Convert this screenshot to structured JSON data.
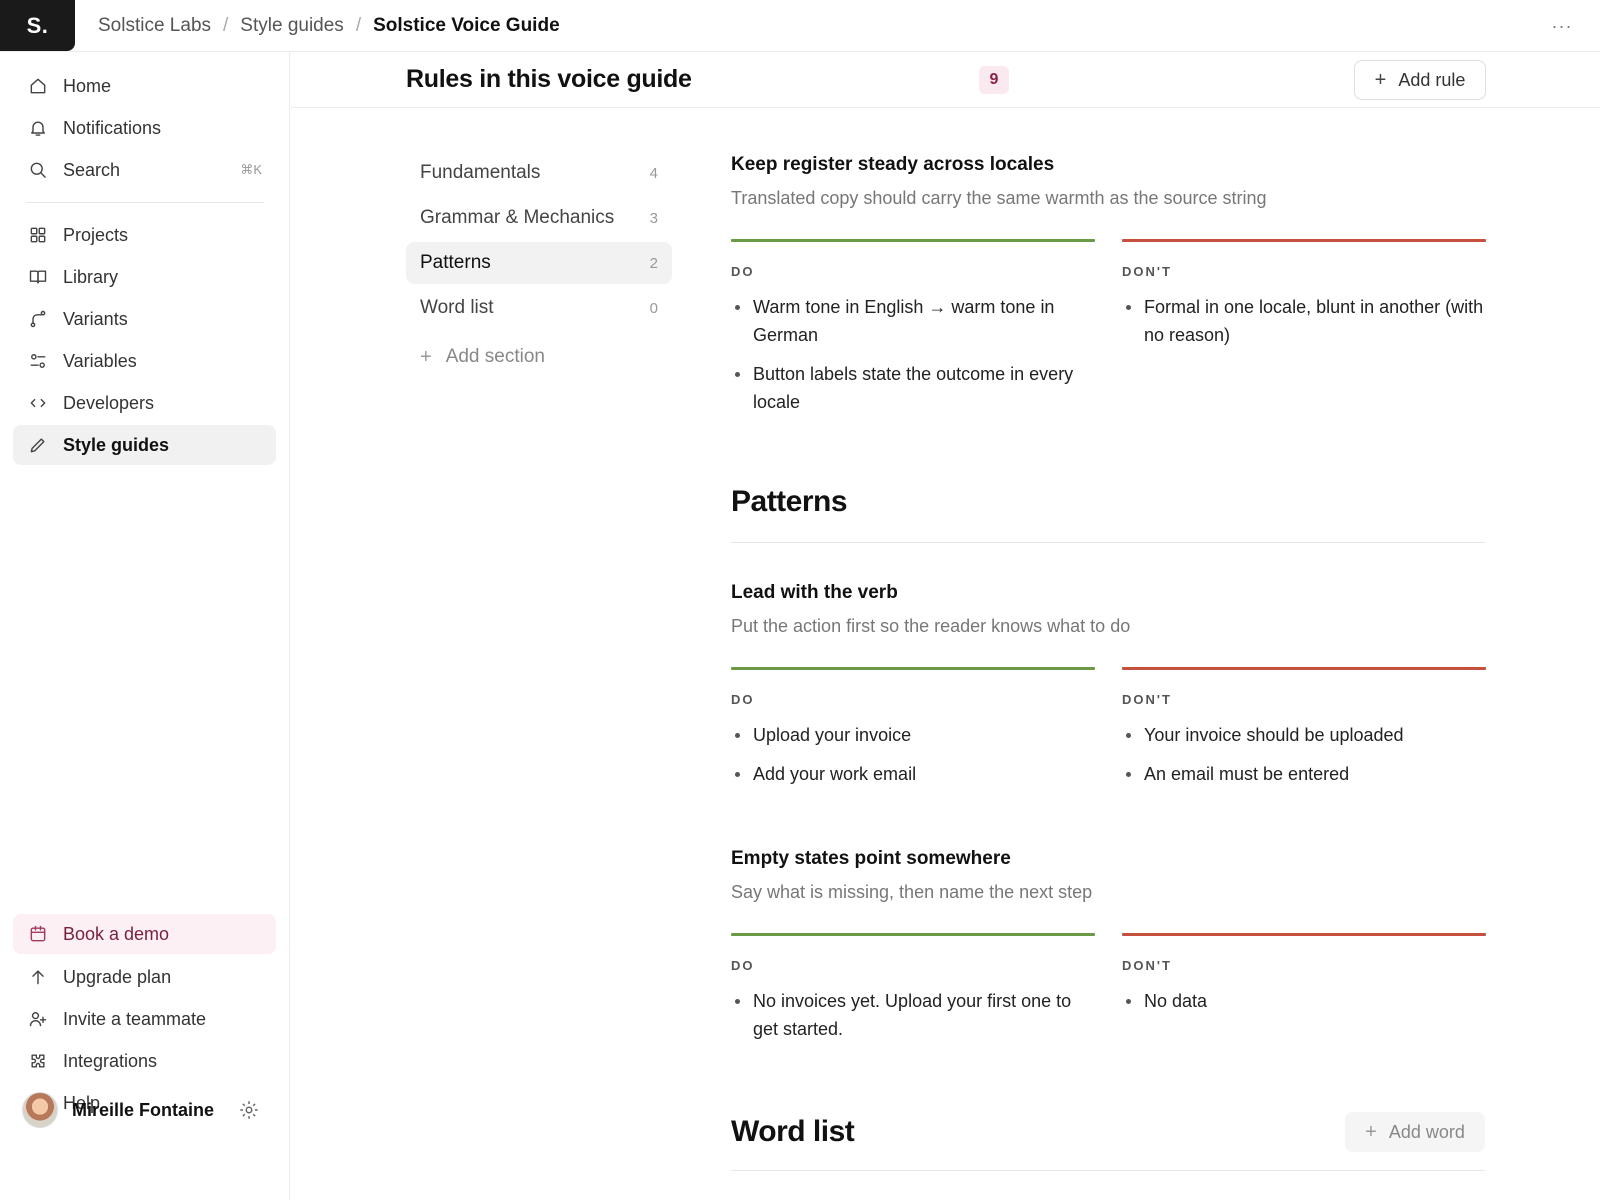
{
  "topbar": {
    "logo": "S.",
    "breadcrumb": [
      "Solstice Labs",
      "Style guides",
      "Solstice Voice Guide"
    ],
    "more_icon": "more-horizontal-icon"
  },
  "sidebar": {
    "primary": [
      {
        "label": "Home",
        "icon": "home-icon"
      },
      {
        "label": "Notifications",
        "icon": "bell-icon"
      },
      {
        "label": "Search",
        "icon": "search-icon",
        "shortcut": "⌘K"
      }
    ],
    "workspace": [
      {
        "label": "Projects",
        "icon": "grid-icon"
      },
      {
        "label": "Library",
        "icon": "book-icon"
      },
      {
        "label": "Variants",
        "icon": "branch-icon"
      },
      {
        "label": "Variables",
        "icon": "variables-icon"
      },
      {
        "label": "Developers",
        "icon": "code-icon"
      },
      {
        "label": "Style guides",
        "icon": "pencil-icon",
        "active": true
      }
    ],
    "bottom": [
      {
        "label": "Book a demo",
        "icon": "calendar-icon",
        "highlight_color": "#fcf0f4"
      },
      {
        "label": "Upgrade plan",
        "icon": "arrow-up-icon"
      },
      {
        "label": "Invite a teammate",
        "icon": "user-plus-icon"
      },
      {
        "label": "Integrations",
        "icon": "puzzle-icon"
      },
      {
        "label": "Help",
        "icon": "help-circle-icon"
      }
    ],
    "user": {
      "name": "Mireille Fontaine",
      "settings_icon": "gear-icon"
    }
  },
  "main": {
    "title": "Rules in this voice guide",
    "rule_count": "9",
    "add_rule_label": "Add rule",
    "sections": [
      {
        "label": "Fundamentals",
        "count": "4"
      },
      {
        "label": "Grammar & Mechanics",
        "count": "3"
      },
      {
        "label": "Patterns",
        "count": "2",
        "active": true
      },
      {
        "label": "Word list",
        "count": "0"
      }
    ],
    "add_section_label": "Add section",
    "rules": [
      {
        "title": "Keep register steady across locales",
        "subtitle": "Translated copy should carry the same warmth as the source string",
        "do_label": "DO",
        "dont_label": "DON'T",
        "do": [
          "Warm tone in English → warm tone in German",
          "Button labels state the outcome in every locale"
        ],
        "dont": [
          "Formal in one locale, blunt in another (with no reason)"
        ]
      },
      {
        "title": "Lead with the verb",
        "subtitle": "Put the action first so the reader knows what to do",
        "do_label": "DO",
        "dont_label": "DON'T",
        "do": [
          "Upload your invoice",
          "Add your work email"
        ],
        "dont": [
          "Your invoice should be uploaded",
          "An email must be entered"
        ]
      },
      {
        "title": "Empty states point somewhere",
        "subtitle": "Say what is missing, then name the next step",
        "do_label": "DO",
        "dont_label": "DON'T",
        "do": [
          "No invoices yet. Upload your first one to get started."
        ],
        "dont": [
          "No data"
        ]
      }
    ],
    "patterns_heading": "Patterns",
    "word_list_heading": "Word list",
    "add_word_label": "Add word"
  },
  "colors": {
    "do_accent": "#6a9a45",
    "dont_accent": "#c6503e",
    "badge_bg": "#fbe9f0",
    "badge_fg": "#8a2147"
  }
}
